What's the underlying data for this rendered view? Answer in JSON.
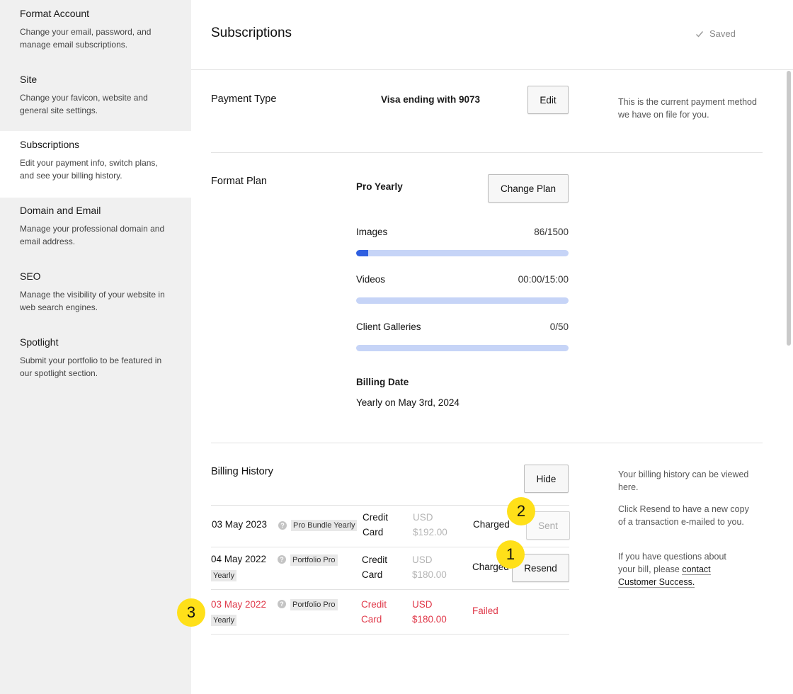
{
  "sidebar": {
    "items": [
      {
        "title": "Format Account",
        "desc": "Change your email, password, and manage email subscriptions."
      },
      {
        "title": "Site",
        "desc": "Change your favicon, website and general site settings."
      },
      {
        "title": "Subscriptions",
        "desc": "Edit your payment info, switch plans, and see your billing history."
      },
      {
        "title": "Domain and Email",
        "desc": "Manage your professional domain and email address."
      },
      {
        "title": "SEO",
        "desc": "Manage the visibility of your website in web search engines."
      },
      {
        "title": "Spotlight",
        "desc": "Submit your portfolio to be featured in our spotlight section."
      }
    ]
  },
  "header": {
    "title": "Subscriptions",
    "saved": "Saved"
  },
  "payment": {
    "label": "Payment Type",
    "card": "Visa ending with 9073",
    "edit": "Edit",
    "helper": "This is the current payment method we have on file for you."
  },
  "plan": {
    "label": "Format Plan",
    "name": "Pro Yearly",
    "change": "Change Plan",
    "usage": [
      {
        "label": "Images",
        "value": "86/1500",
        "fraction": 0.057
      },
      {
        "label": "Videos",
        "value": "00:00/15:00",
        "fraction": 0
      },
      {
        "label": "Client Galleries",
        "value": "0/50",
        "fraction": 0
      }
    ],
    "billing_date_title": "Billing Date",
    "billing_date_value": "Yearly on May 3rd, 2024"
  },
  "history": {
    "label": "Billing History",
    "hide": "Hide",
    "helper1": "Your billing history can be viewed here.",
    "helper2": "Click Resend to have a new copy of a transaction e-mailed to you.",
    "helper3": "If you have questions about your bill, please",
    "helper_link": "contact Customer Success.",
    "rows": [
      {
        "date": "03 May 2023",
        "plan": "Pro Bundle Yearly",
        "method": "Credit Card",
        "amount": "USD $192.00",
        "status": "Charged",
        "action": "Sent"
      },
      {
        "date": "04 May 2022",
        "plan": "Portfolio Pro Yearly",
        "method": "Credit Card",
        "amount": "USD $180.00",
        "status": "Charged",
        "action": "Resend"
      },
      {
        "date": "03 May 2022",
        "plan": "Portfolio Pro Yearly",
        "method": "Credit Card",
        "amount": "USD $180.00",
        "status": "Failed",
        "action": ""
      }
    ]
  },
  "markers": [
    "1",
    "2",
    "3"
  ],
  "colors": {
    "accent": "#2f5fe0",
    "bar_bg": "#c6d4f7",
    "error": "#e0394a",
    "marker": "#ffe019"
  }
}
